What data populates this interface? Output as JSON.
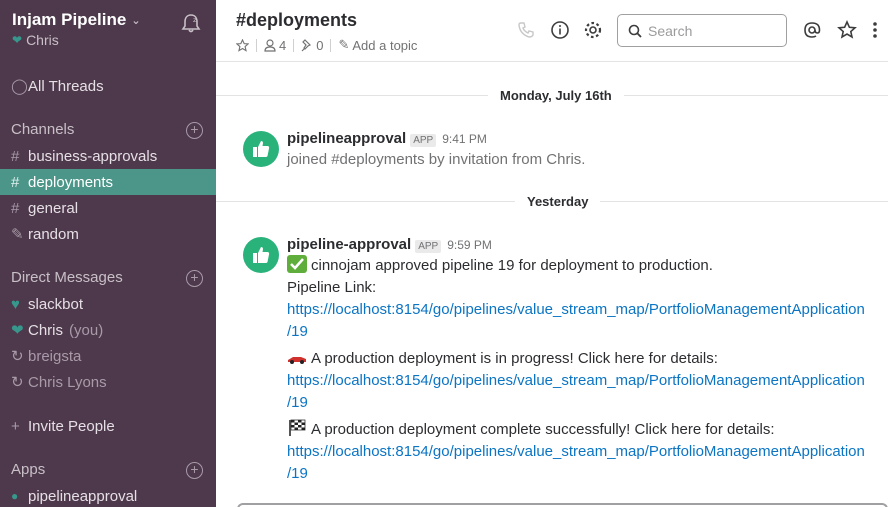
{
  "sidebar": {
    "team_name": "Injam Pipeline",
    "user": "Chris",
    "all_threads": "All Threads",
    "channels_header": "Channels",
    "channels": [
      {
        "name": "business-approvals",
        "active": false
      },
      {
        "name": "deployments",
        "active": true
      },
      {
        "name": "general",
        "active": false
      },
      {
        "name": "random",
        "active": false
      }
    ],
    "dm_header": "Direct Messages",
    "dms": [
      {
        "name": "slackbot",
        "suffix": ""
      },
      {
        "name": "Chris",
        "suffix": "(you)"
      },
      {
        "name": "breigsta",
        "suffix": ""
      },
      {
        "name": "Chris Lyons",
        "suffix": ""
      }
    ],
    "invite": "Invite People",
    "apps_header": "Apps",
    "apps": [
      {
        "name": "pipelineapproval"
      }
    ]
  },
  "header": {
    "channel": "#deployments",
    "members": "4",
    "pins": "0",
    "add_topic": "Add a topic",
    "search_placeholder": "Search"
  },
  "messages": {
    "day1": "Monday, July 16th",
    "msg1": {
      "name": "pipelineapproval",
      "badge": "APP",
      "time": "9:41 PM",
      "text": "joined #deployments by invitation from Chris."
    },
    "day2": "Yesterday",
    "msg2": {
      "name": "pipeline-approval",
      "badge": "APP",
      "time": "9:59 PM",
      "line1": "cinnojam approved pipeline 19 for deployment to production.",
      "line2": "Pipeline Link:",
      "link1a": "https://localhost:8154/go/pipelines/value_stream_map/PortfolioManagementApplication",
      "link1b": "/19",
      "line3": "A production deployment is in progress! Click here for details:",
      "link2a": "https://localhost:8154/go/pipelines/value_stream_map/PortfolioManagementApplication",
      "link2b": "/19",
      "line4": "A production deployment complete successfully! Click here for details:",
      "link3a": "https://localhost:8154/go/pipelines/value_stream_map/PortfolioManagementApplication",
      "link3b": "/19"
    }
  },
  "colors": {
    "sidebar_bg": "#4d394b",
    "active_channel": "#4c9689",
    "link": "#0b75c4",
    "app_avatar": "#2ab27b"
  }
}
